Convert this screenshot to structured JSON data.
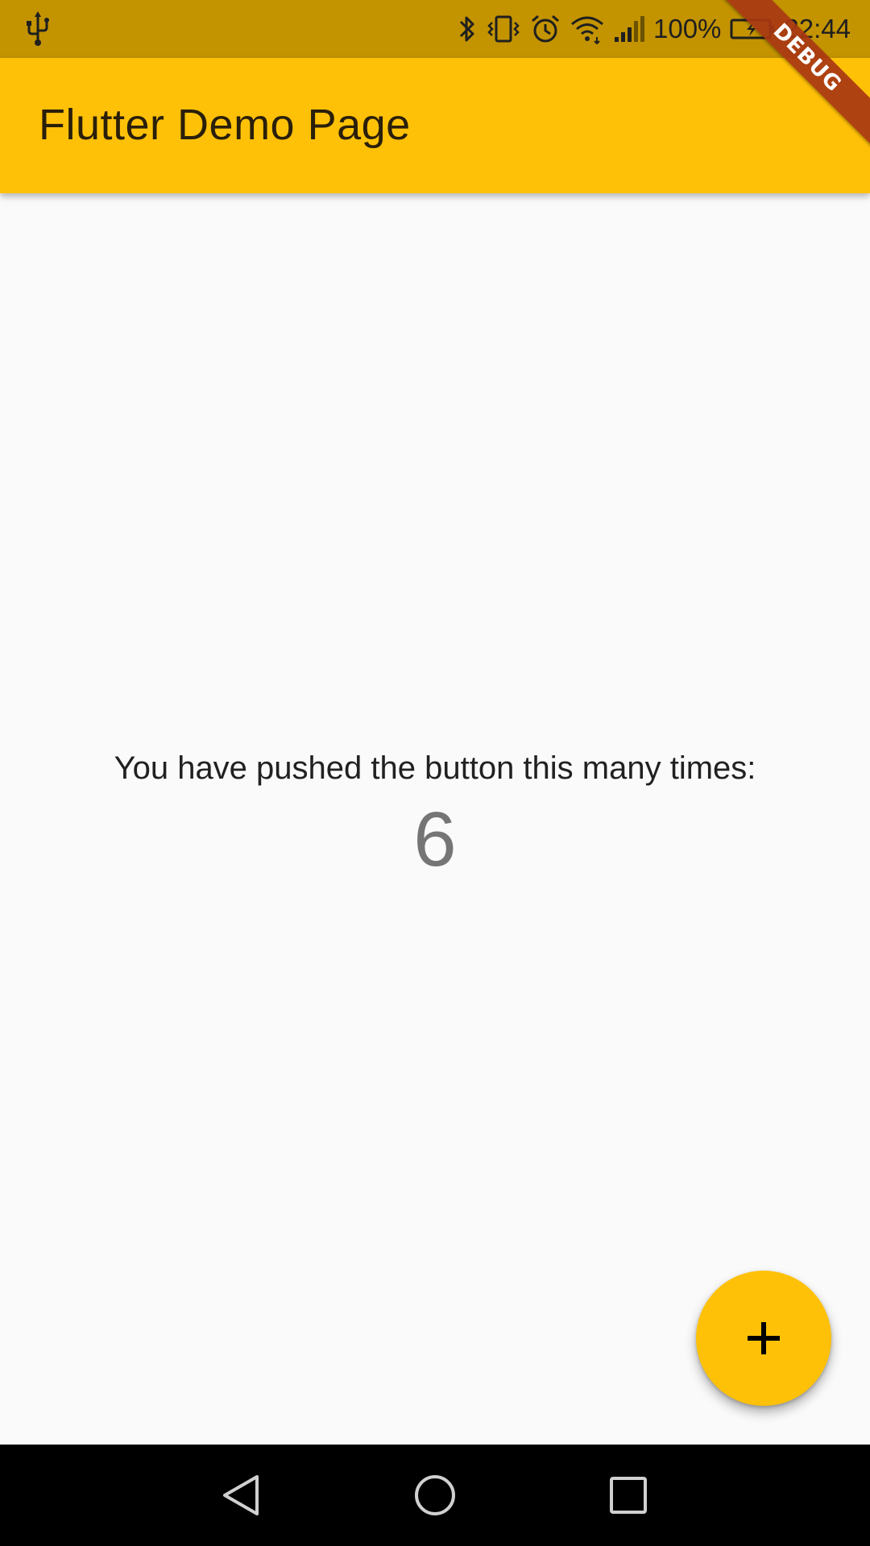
{
  "status_bar": {
    "battery_percent": "100%",
    "time": "22:44",
    "icons": [
      "usb-icon",
      "bluetooth-icon",
      "vibrate-icon",
      "alarm-icon",
      "wifi-icon",
      "signal-icon",
      "battery-charging-icon"
    ]
  },
  "debug_banner": {
    "label": "DEBUG"
  },
  "app_bar": {
    "title": "Flutter Demo Page",
    "color": "#ffc107"
  },
  "body": {
    "message": "You have pushed the button this many times:",
    "counter": "6"
  },
  "fab": {
    "icon": "plus-icon",
    "color": "#ffc107"
  },
  "nav_bar": {
    "buttons": [
      "back-icon",
      "home-icon",
      "recents-icon"
    ]
  }
}
